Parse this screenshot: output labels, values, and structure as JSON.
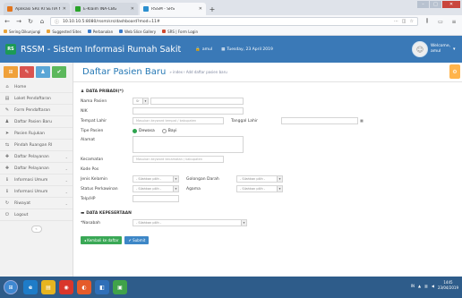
{
  "browser": {
    "tabs": [
      {
        "label": "Aplikasi SRs RI SETIA MITRA",
        "color": "#e2751c"
      },
      {
        "label": "E-Klaim INA-CBG",
        "color": "#29a329"
      },
      {
        "label": "RSSM - SRS",
        "color": "#2b8fcf"
      }
    ],
    "url": "10.10.10.5:8080/rssm/srs/dashboard?mod=11#",
    "bookmarks": [
      {
        "label": "Sering Dikunjungi",
        "color": "#e8a33a"
      },
      {
        "label": "Suggested Sites",
        "color": "#e8a33a"
      },
      {
        "label": "Perbanalan",
        "color": "#3a7ac9"
      },
      {
        "label": "Web Slice Gallery",
        "color": "#3a7ac9"
      },
      {
        "label": "SRS | Form Login",
        "color": "#d0492e"
      }
    ]
  },
  "header": {
    "logo": "RS",
    "app_title": "RSSM - Sistem Informasi Rumah Sakit",
    "user": "amul",
    "date": "Tuesday, 23 April 2019",
    "welcome": "Welcome,",
    "welcome_user": "amul"
  },
  "sidebar": {
    "shortcuts": [
      {
        "icon": "⊞",
        "color": "#f0a13a"
      },
      {
        "icon": "✎",
        "color": "#d9534f"
      },
      {
        "icon": "♟",
        "color": "#5aa6d6"
      },
      {
        "icon": "✔",
        "color": "#5cb85c"
      }
    ],
    "items": [
      {
        "label": "Home",
        "icon": "⌂",
        "chevron": ""
      },
      {
        "label": "Loket Pendaftaran",
        "icon": "▤",
        "chevron": ""
      },
      {
        "label": "Form Pendaftaran",
        "icon": "✎",
        "chevron": ""
      },
      {
        "label": "Daftar Pasien Baru",
        "icon": "♟",
        "chevron": ""
      },
      {
        "label": "Pasien Rujukan",
        "icon": "➤",
        "chevron": ""
      },
      {
        "label": "Pindah Ruangan RI",
        "icon": "⇆",
        "chevron": ""
      },
      {
        "label": "Daftar Pelayanan",
        "icon": "✚",
        "chevron": "⌄"
      },
      {
        "label": "Daftar Pelayanan",
        "icon": "✚",
        "chevron": "⌄"
      },
      {
        "label": "Informasi Umum",
        "icon": "ℹ",
        "chevron": "⌄"
      },
      {
        "label": "Informasi Umum",
        "icon": "ℹ",
        "chevron": "⌄"
      },
      {
        "label": "Riwayat",
        "icon": "↻",
        "chevron": "⌄"
      },
      {
        "label": "Logout",
        "icon": "⏻",
        "chevron": ""
      }
    ],
    "collapse": "«"
  },
  "main": {
    "title": "Daftar Pasien Baru",
    "breadcrumb_index": "» index",
    "breadcrumb_sub": "Add daftar pasien baru",
    "section_personal": "DATA PRIBADI(*)",
    "fields": {
      "nama_pasien": {
        "label": "Nama Pasien",
        "prefix": "Sr",
        "value": ""
      },
      "nik": {
        "label": "NIK",
        "value": ""
      },
      "tempat_lahir": {
        "label": "Tempat Lahir",
        "placeholder": "Masukan keyword tempat / kabupaten"
      },
      "tanggal_lahir": {
        "label": "Tanggal Lahir",
        "value": ""
      },
      "tipe_pasien": {
        "label": "Tipe Pasien",
        "options": [
          "Dewasa",
          "Bayi"
        ],
        "selected": "Dewasa"
      },
      "alamat": {
        "label": "Alamat",
        "value": ""
      },
      "kecamatan": {
        "label": "Kecamatan",
        "placeholder": "Masukan keyword kecamatan / kabupaten"
      },
      "kode_pos": {
        "label": "Kode Pos",
        "value": ""
      },
      "jenis_kelamin": {
        "label": "Jenis Kelamin",
        "value": "- Silahkan pilih -"
      },
      "golongan_darah": {
        "label": "Golongan Darah",
        "value": "- Silahkan pilih -"
      },
      "status_perkawinan": {
        "label": "Status Perkawinan",
        "value": "- Silahkan pilih -"
      },
      "agama": {
        "label": "Agama",
        "value": "- Silahkan pilih -"
      },
      "telp": {
        "label": "Telp/HP",
        "value": ""
      }
    },
    "section_membership": "DATA KEPESERTAAN",
    "nasabah": {
      "label": "*Nasabah",
      "value": "- Silahkan pilih -"
    },
    "buttons": {
      "back": "Kembali ke daftar",
      "submit": "Submit"
    }
  },
  "taskbar": {
    "apps": [
      {
        "icon": "e",
        "color": "#1e7cc8"
      },
      {
        "icon": "▤",
        "color": "#e6b420"
      },
      {
        "icon": "◉",
        "color": "#d9362b"
      },
      {
        "icon": "◐",
        "color": "#e55b2a"
      },
      {
        "icon": "◧",
        "color": "#2f6fb8"
      },
      {
        "icon": "▣",
        "color": "#40a24a"
      }
    ],
    "lang": "IN",
    "time": "1445",
    "date": "23/04/2019"
  }
}
